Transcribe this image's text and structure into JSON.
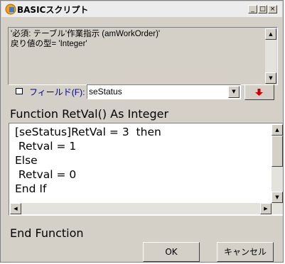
{
  "window": {
    "title": "BASICスクリプト"
  },
  "titlebar_buttons": {
    "minimize": "_",
    "maximize": "□",
    "close": "×"
  },
  "description": {
    "text": "'必須: テーブル'作業指示 (amWorkOrder)'\n戻り値の型= 'Integer'"
  },
  "field": {
    "label": "フィールド(F):",
    "value": "seStatus"
  },
  "script": {
    "header": "Function RetVal() As Integer",
    "code": "[seStatus]RetVal = 3  then\n Retval = 1\nElse\n Retval = 0\nEnd If",
    "footer": "End Function"
  },
  "buttons": {
    "ok": "OK",
    "cancel": "キャンセル"
  },
  "icons": {
    "app": "app-icon",
    "insert": "insert-arrow-icon",
    "field": "field-icon"
  },
  "colors": {
    "field_label": "#00008b",
    "insert_arrow": "#cc0000",
    "window_bg": "#d4d0c8"
  }
}
